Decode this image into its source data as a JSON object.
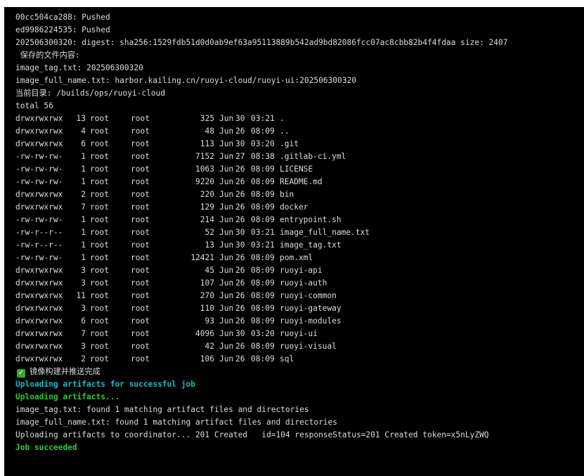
{
  "pre_lines": [
    "00cc504ca288: Pushed",
    "ed9986224535: Pushed",
    "202506300320: digest: sha256:1529fdb51d0d0ab9ef63a95113889b542ad9bd82086fcc07ac8cbb82b4f4fdaa size: 2407",
    " 保存的文件内容:",
    "image_tag.txt: 202506300320",
    "image_full_name.txt: harbor.kailing.cn/ruoyi-cloud/ruoyi-ui:202506300320",
    "当前目录: /builds/ops/ruoyi-cloud",
    "total 56"
  ],
  "listing": [
    {
      "perm": "drwxrwxrwx",
      "links": "13",
      "owner": "root",
      "group": "root",
      "size": "325",
      "month": "Jun",
      "day": "30",
      "time": "03:21",
      "name": "."
    },
    {
      "perm": "drwxrwxrwx",
      "links": "4",
      "owner": "root",
      "group": "root",
      "size": "48",
      "month": "Jun",
      "day": "26",
      "time": "08:09",
      "name": ".."
    },
    {
      "perm": "drwxrwxrwx",
      "links": "6",
      "owner": "root",
      "group": "root",
      "size": "113",
      "month": "Jun",
      "day": "30",
      "time": "03:20",
      "name": ".git"
    },
    {
      "perm": "-rw-rw-rw-",
      "links": "1",
      "owner": "root",
      "group": "root",
      "size": "7152",
      "month": "Jun",
      "day": "27",
      "time": "08:38",
      "name": ".gitlab-ci.yml"
    },
    {
      "perm": "-rw-rw-rw-",
      "links": "1",
      "owner": "root",
      "group": "root",
      "size": "1063",
      "month": "Jun",
      "day": "26",
      "time": "08:09",
      "name": "LICENSE"
    },
    {
      "perm": "-rw-rw-rw-",
      "links": "1",
      "owner": "root",
      "group": "root",
      "size": "9220",
      "month": "Jun",
      "day": "26",
      "time": "08:09",
      "name": "README.md"
    },
    {
      "perm": "drwxrwxrwx",
      "links": "2",
      "owner": "root",
      "group": "root",
      "size": "220",
      "month": "Jun",
      "day": "26",
      "time": "08:09",
      "name": "bin"
    },
    {
      "perm": "drwxrwxrwx",
      "links": "7",
      "owner": "root",
      "group": "root",
      "size": "129",
      "month": "Jun",
      "day": "26",
      "time": "08:09",
      "name": "docker"
    },
    {
      "perm": "-rw-rw-rw-",
      "links": "1",
      "owner": "root",
      "group": "root",
      "size": "214",
      "month": "Jun",
      "day": "26",
      "time": "08:09",
      "name": "entrypoint.sh"
    },
    {
      "perm": "-rw-r--r--",
      "links": "1",
      "owner": "root",
      "group": "root",
      "size": "52",
      "month": "Jun",
      "day": "30",
      "time": "03:21",
      "name": "image_full_name.txt"
    },
    {
      "perm": "-rw-r--r--",
      "links": "1",
      "owner": "root",
      "group": "root",
      "size": "13",
      "month": "Jun",
      "day": "30",
      "time": "03:21",
      "name": "image_tag.txt"
    },
    {
      "perm": "-rw-rw-rw-",
      "links": "1",
      "owner": "root",
      "group": "root",
      "size": "12421",
      "month": "Jun",
      "day": "26",
      "time": "08:09",
      "name": "pom.xml"
    },
    {
      "perm": "drwxrwxrwx",
      "links": "3",
      "owner": "root",
      "group": "root",
      "size": "45",
      "month": "Jun",
      "day": "26",
      "time": "08:09",
      "name": "ruoyi-api"
    },
    {
      "perm": "drwxrwxrwx",
      "links": "3",
      "owner": "root",
      "group": "root",
      "size": "107",
      "month": "Jun",
      "day": "26",
      "time": "08:09",
      "name": "ruoyi-auth"
    },
    {
      "perm": "drwxrwxrwx",
      "links": "11",
      "owner": "root",
      "group": "root",
      "size": "270",
      "month": "Jun",
      "day": "26",
      "time": "08:09",
      "name": "ruoyi-common"
    },
    {
      "perm": "drwxrwxrwx",
      "links": "3",
      "owner": "root",
      "group": "root",
      "size": "110",
      "month": "Jun",
      "day": "26",
      "time": "08:09",
      "name": "ruoyi-gateway"
    },
    {
      "perm": "drwxrwxrwx",
      "links": "6",
      "owner": "root",
      "group": "root",
      "size": "93",
      "month": "Jun",
      "day": "26",
      "time": "08:09",
      "name": "ruoyi-modules"
    },
    {
      "perm": "drwxrwxrwx",
      "links": "7",
      "owner": "root",
      "group": "root",
      "size": "4096",
      "month": "Jun",
      "day": "30",
      "time": "03:20",
      "name": "ruoyi-ui"
    },
    {
      "perm": "drwxrwxrwx",
      "links": "3",
      "owner": "root",
      "group": "root",
      "size": "42",
      "month": "Jun",
      "day": "26",
      "time": "08:09",
      "name": "ruoyi-visual"
    },
    {
      "perm": "drwxrwxrwx",
      "links": "2",
      "owner": "root",
      "group": "root",
      "size": "106",
      "month": "Jun",
      "day": "26",
      "time": "08:09",
      "name": "sql"
    }
  ],
  "status": {
    "check_icon": "check-mark-icon",
    "build_done": "镜像构建并推送完成",
    "uploading_artifacts_success": "Uploading artifacts for successful job",
    "uploading_artifacts": "Uploading artifacts...",
    "found_image_tag": "image_tag.txt: found 1 matching artifact files and directories",
    "found_image_full_name": "image_full_name.txt: found 1 matching artifact files and directories",
    "upload_result": "Uploading artifacts to coordinator... 201 Created   id=104 responseStatus=201 Created token=x5nLyZWQ",
    "job_succeeded": "Job succeeded"
  },
  "colors": {
    "background": "#000000",
    "text": "#dcdcdc",
    "success_green": "#32c832",
    "info_cyan": "#1ab9c8",
    "check_badge": "#2faa2f"
  }
}
